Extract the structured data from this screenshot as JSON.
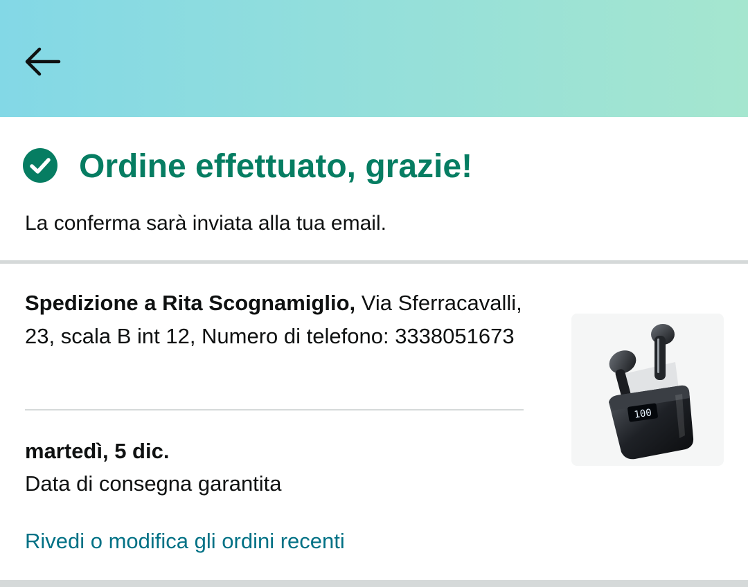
{
  "header": {
    "back_icon": "arrow-left-icon",
    "gradient_start": "#83d8e6",
    "gradient_end": "#a5e6cf"
  },
  "confirmation": {
    "icon": "check-circle-icon",
    "title": "Ordine effettuato, grazie!",
    "subtitle": "La conferma sarà inviata alla tua email.",
    "accent_color": "#067d62"
  },
  "shipping": {
    "label": "Spedizione a Rita Scognamiglio,",
    "address": " Via Sferracavalli, 23, scala B int 12, Numero di telefono: 3338051673"
  },
  "delivery": {
    "date": "martedì, 5 dic.",
    "note": "Data di consegna garantita"
  },
  "links": {
    "review_orders": "Rivedi o modifica gli ordini recenti",
    "link_color": "#007185"
  },
  "product": {
    "image_icon": "wireless-earbuds-image",
    "display_digits": "100"
  }
}
